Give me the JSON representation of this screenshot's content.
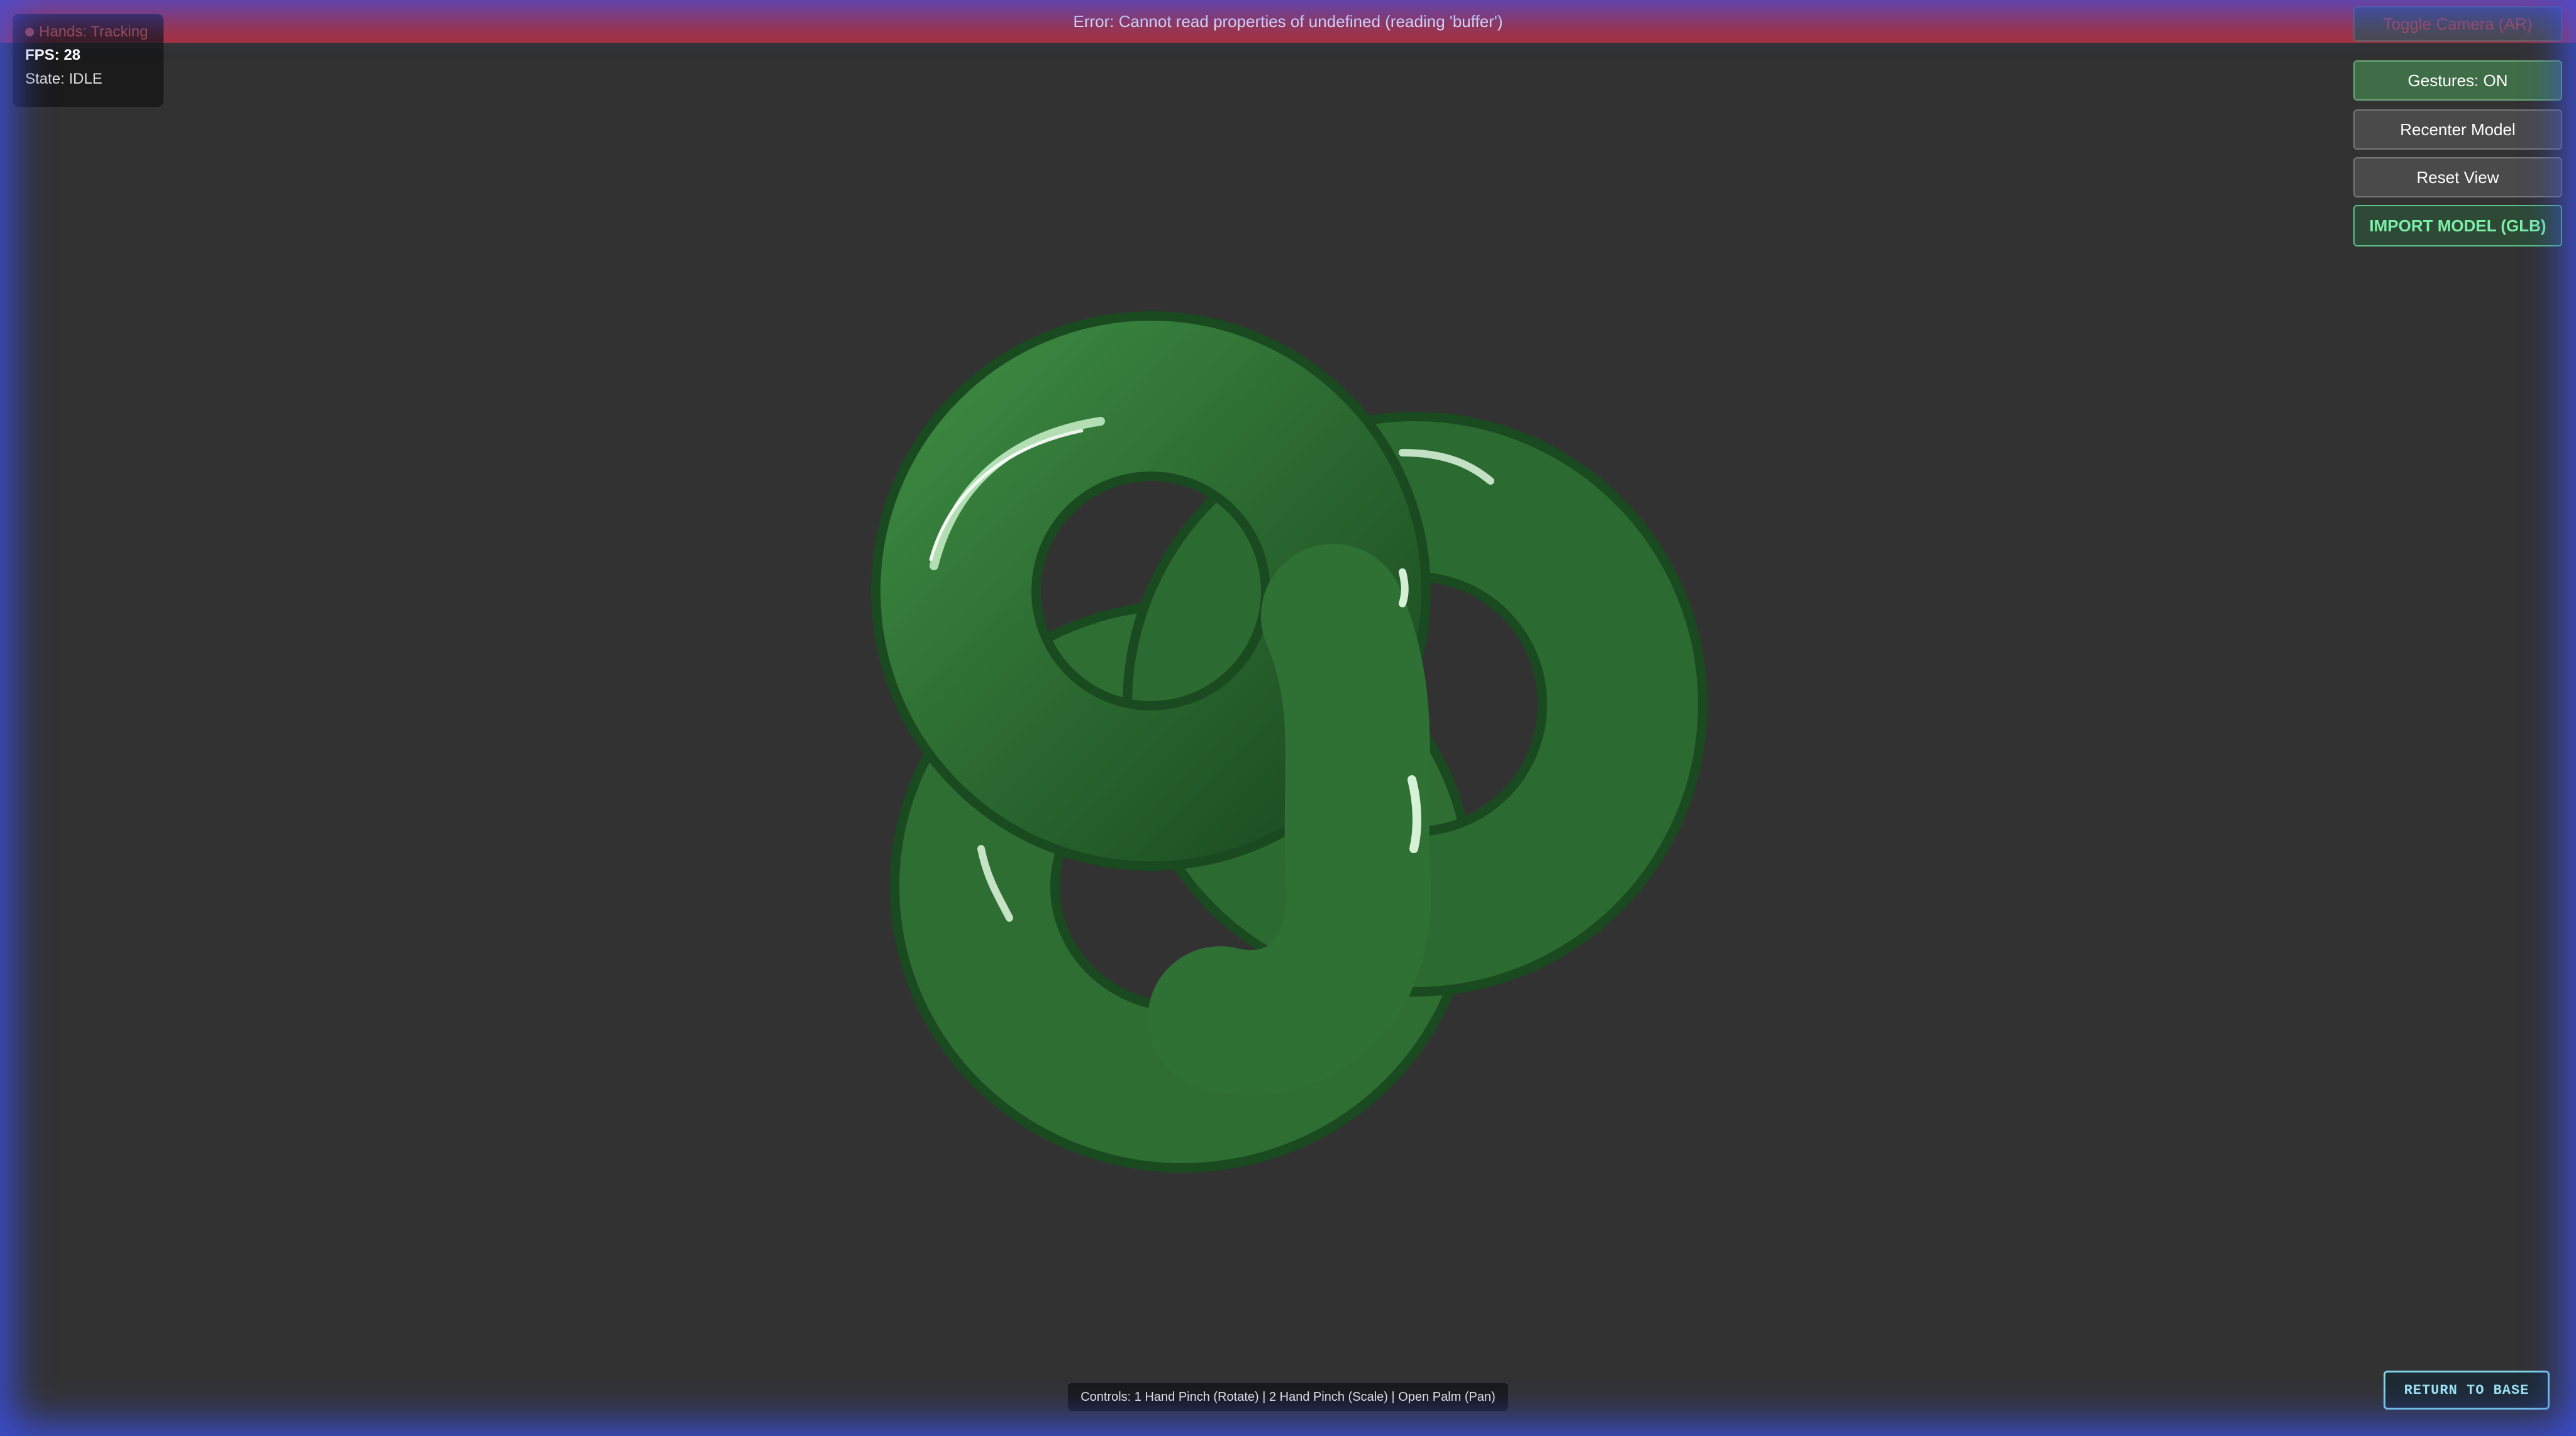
{
  "error_banner": {
    "message": "Error: Cannot read properties of undefined (reading 'buffer')"
  },
  "hud": {
    "hands_label": "Hands: Tracking",
    "fps_label": "FPS: 28",
    "state_label": "State: IDLE"
  },
  "toolbar": {
    "toggle_camera_label": "Toggle Camera (AR)",
    "gestures_label": "Gestures: ON",
    "recenter_label": "Recenter Model",
    "reset_view_label": "Reset View",
    "import_label": "IMPORT MODEL (GLB)"
  },
  "footer": {
    "controls_hint": "Controls: 1 Hand Pinch (Rotate) | 2 Hand Pinch (Scale) | Open Palm (Pan)",
    "return_label": "RETURN TO BASE"
  },
  "colors": {
    "background": "#323232",
    "error": "#a8313a",
    "model_green": "#2f6e33",
    "gestures_on": "#3f6d48",
    "import_accent": "#7cf0a8",
    "return_accent": "#9fe6f5",
    "vignette": "#3c50e6"
  },
  "icons": {
    "hands_status": "status-dot-icon"
  }
}
